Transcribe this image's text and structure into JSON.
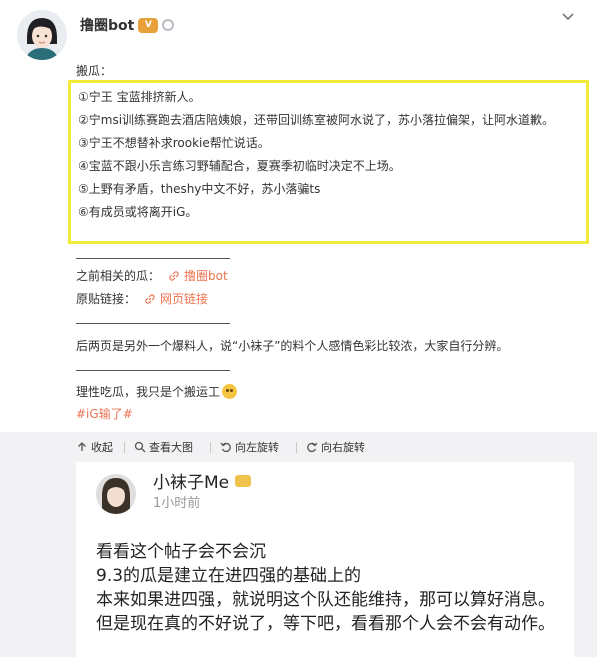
{
  "post": {
    "author": "撸圈bot",
    "badges": [
      "vip-badge",
      "ring-badge"
    ],
    "heading": "搬瓜：",
    "highlight_items": [
      "①宁王 宝蓝排挤新人。",
      "②宁msi训练赛跑去酒店陪姨娘，还带回训练室被阿水说了，苏小落拉偏架，让阿水道歉。",
      "③宁王不想替补求rookie帮忙说话。",
      "④宝蓝不跟小乐言练习野辅配合，夏赛季初临时决定不上场。",
      "⑤上野有矛盾，theshy中文不好，苏小落骗ts",
      "⑥有成员或将离开iG。"
    ],
    "related_label": "之前相关的瓜：",
    "related_link": "撸圈bot",
    "source_label": "原贴链接：",
    "source_link": "网页链接",
    "note": "后两页是另外一个爆料人，说“小袜子”的料个人感情色彩比较浓，大家自行分辨。",
    "closing": "理性吃瓜，我只是个搬运工",
    "hashtag": "#iG输了#"
  },
  "toolbar": {
    "collapse": "收起",
    "view_large": "查看大图",
    "rotate_left": "向左旋转",
    "rotate_right": "向右旋转"
  },
  "embed": {
    "name": "小袜子Me",
    "time": "1小时前",
    "lines": [
      "看看这个帖子会不会沉",
      "9.3的瓜是建立在进四强的基础上的",
      "本来如果进四强，就说明这个队还能维持，那可以算好消息。但是现在真的不好说了，等下吧，看看那个人会不会有动作。"
    ]
  },
  "icons": [
    "chevron-down-icon",
    "link-icon",
    "collapse-icon",
    "search-icon",
    "rotate-left-icon",
    "rotate-right-icon"
  ],
  "colors": {
    "highlight_border": "#f2eb3a",
    "link": "#eb7350",
    "toolbar_bg": "#f2f2f5"
  }
}
